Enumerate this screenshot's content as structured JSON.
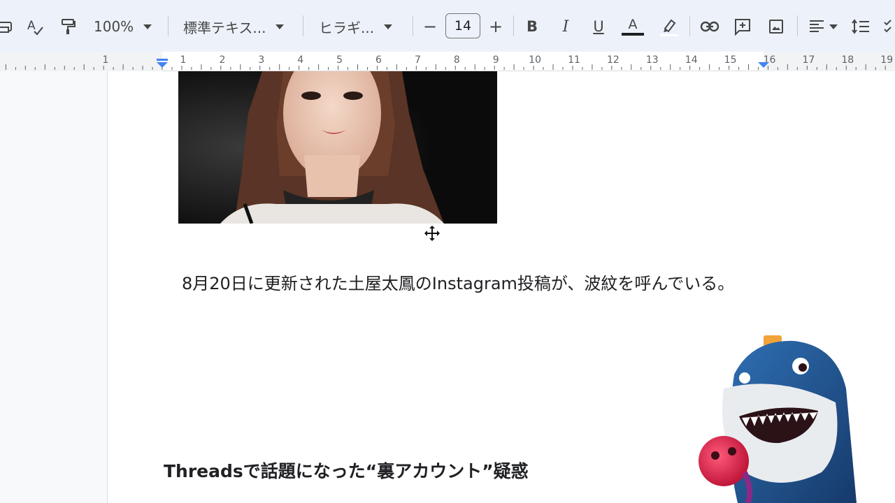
{
  "toolbar": {
    "zoom": "100%",
    "style": "標準テキス...",
    "font": "ヒラギ...",
    "font_size": "14",
    "minus": "−",
    "plus": "+",
    "bold": "B",
    "italic": "I",
    "underline": "U",
    "text_color": "A"
  },
  "ruler": {
    "left_labels": [
      "1"
    ],
    "labels": [
      "1",
      "2",
      "3",
      "4",
      "5",
      "6",
      "7",
      "8",
      "9",
      "10",
      "11",
      "12",
      "13",
      "14",
      "15",
      "16",
      "17",
      "18",
      "19"
    ]
  },
  "document": {
    "paragraph": "8月20日に更新された土屋太鳳のInstagram投稿が、波紋を呼んでいる。",
    "heading": "Threadsで話題になった“裏アカウント”疑惑"
  },
  "colors": {
    "toolbar_bg": "#edf2fa",
    "accent_blue": "#4285f4",
    "text": "#202124"
  }
}
